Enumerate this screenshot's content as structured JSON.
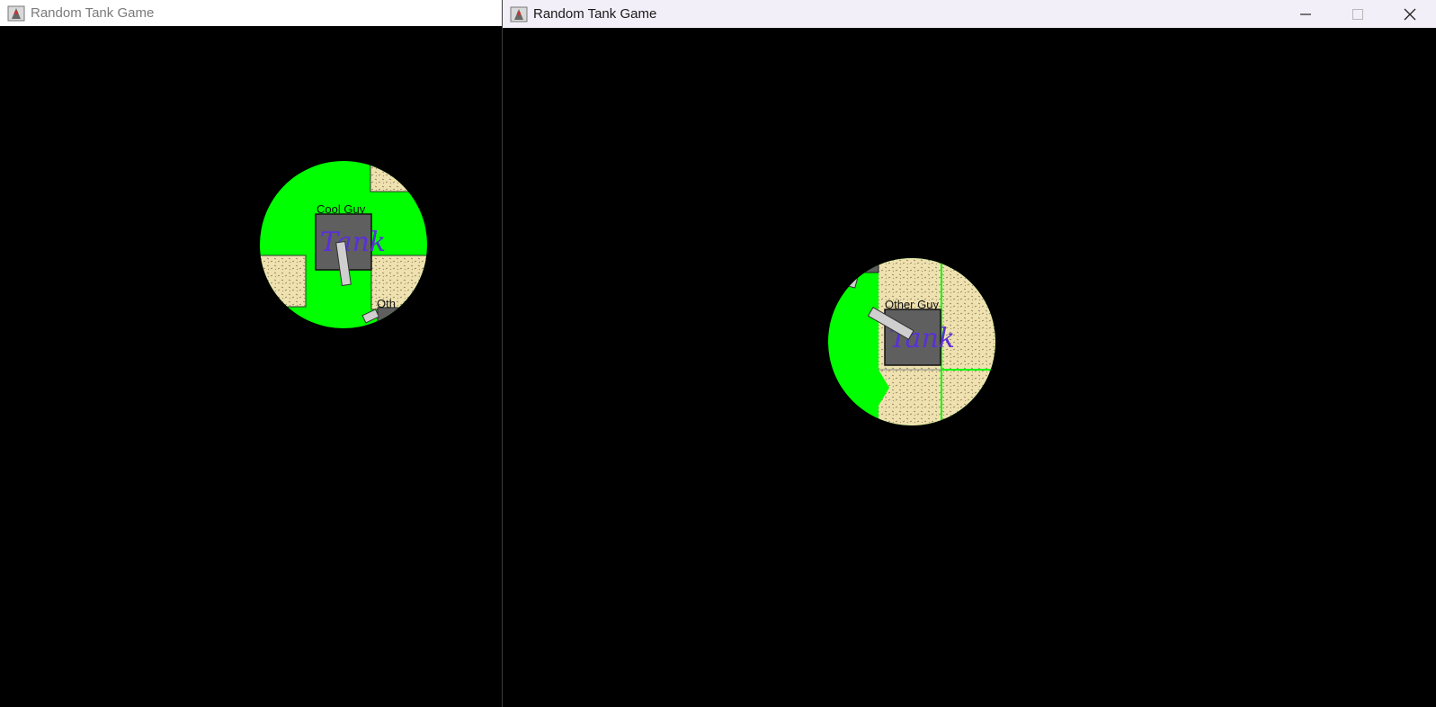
{
  "windows": [
    {
      "title": "Random Tank Game",
      "player_label": "Cool Guy",
      "other_label": "Oth",
      "tank_text": "Tank"
    },
    {
      "title": "Random Tank Game",
      "player_label": "Other Guy",
      "tank_text": "Tank",
      "controls": {
        "minimize": "—",
        "maximize": "☐",
        "close": "✕"
      }
    }
  ],
  "colors": {
    "grass": "#00ff00",
    "sand": "#efe2b0",
    "tank_body": "#5f5f5f",
    "barrel": "#cfcfcf",
    "background": "#000000"
  },
  "icons": {
    "app": "java-duke-icon"
  }
}
